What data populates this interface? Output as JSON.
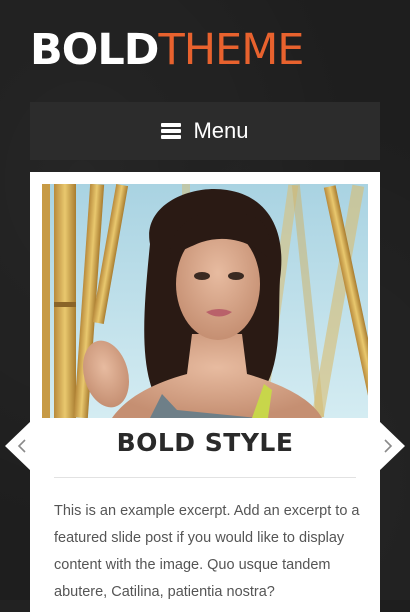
{
  "logo": {
    "part1": "BOLD",
    "part2": "THEME"
  },
  "nav": {
    "menu_label": "Menu",
    "icon": "hamburger-icon"
  },
  "slide": {
    "image": "featured-portrait-photo",
    "title": "BOLD STYLE",
    "excerpt": "This is an example excerpt. Add an excerpt to a featured slide post if you would like to display content with the image. Quo usque tandem abutere, Catilina, patientia nostra?"
  },
  "slider": {
    "prev_icon": "chevron-left-icon",
    "next_icon": "chevron-right-icon"
  },
  "colors": {
    "background": "#1e1e1e",
    "accent": "#e8622e",
    "menu_bar": "#2c2c2c",
    "card": "#ffffff",
    "title_text": "#2a2a2a",
    "body_text": "#555555"
  }
}
